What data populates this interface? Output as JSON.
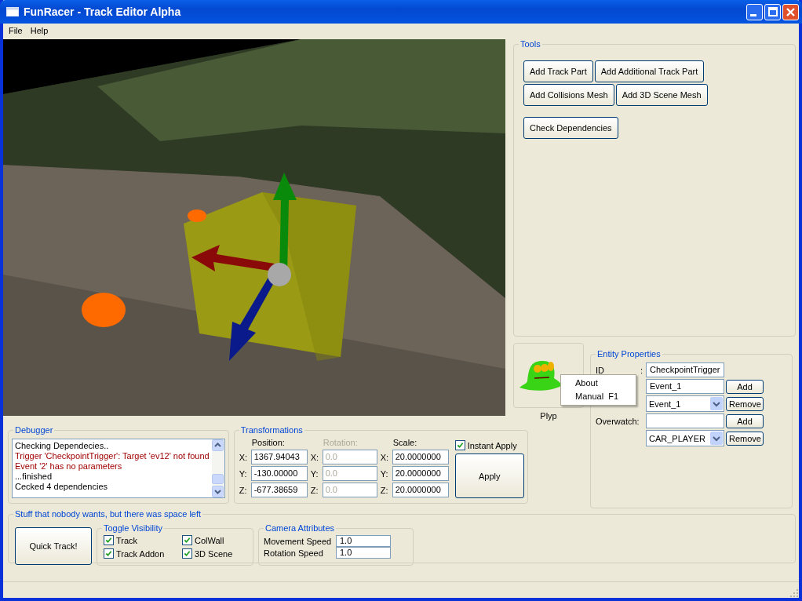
{
  "window": {
    "title": "FunRacer - Track Editor Alpha"
  },
  "menu": [
    "File",
    "Help"
  ],
  "viewport": {
    "kind": "picture"
  },
  "tools": {
    "title": "Tools",
    "rows": [
      [
        "Add Track Part",
        "Add Additional Track Part"
      ],
      [
        "Add Collisions Mesh",
        "Add 3D Scene Mesh"
      ],
      [
        "Check Dependencies"
      ]
    ]
  },
  "mascot": {
    "label": "Plyp"
  },
  "context_menu": [
    {
      "label": "About"
    },
    {
      "label": "Manual",
      "shortcut": "F1"
    }
  ],
  "entity_properties": {
    "title": "Entity Properties",
    "rows": [
      {
        "kind": "field",
        "label_parts": [
          "ID",
          ":"
        ],
        "value": "CheckpointTrigger"
      },
      {
        "kind": "field",
        "value": "Event_1",
        "button": "Add"
      },
      {
        "kind": "combo",
        "value": "Event_1",
        "button": "Remove"
      },
      {
        "kind": "field",
        "label": "Overwatch:",
        "button": "Add"
      },
      {
        "kind": "combo",
        "value": "CAR_PLAYER",
        "button": "Remove"
      }
    ]
  },
  "debugger": {
    "title": "Debugger",
    "lines": [
      {
        "kind": "info",
        "text": "Checking Dependecies.."
      },
      {
        "kind": "error",
        "text": "Trigger 'CheckpointTrigger': Target 'ev12' not found"
      },
      {
        "kind": "error",
        "text": "Event '2' has no parameters"
      },
      {
        "kind": "info",
        "text": "...finished"
      },
      {
        "kind": "info",
        "text": "Cecked 4 dependencies"
      }
    ]
  },
  "transformations": {
    "title": "Transformations",
    "groups": [
      {
        "label": "Position:",
        "disabled": false,
        "fields": [
          {
            "axis": "X:",
            "value": "1367.94043"
          },
          {
            "axis": "Y:",
            "value": "-130.00000"
          },
          {
            "axis": "Z:",
            "value": "-677.38659"
          }
        ]
      },
      {
        "label": "Rotation:",
        "disabled": true,
        "fields": [
          {
            "axis": "X:",
            "value": "0.0"
          },
          {
            "axis": "Y:",
            "value": "0.0"
          },
          {
            "axis": "Z:",
            "value": "0.0"
          }
        ]
      },
      {
        "label": "Scale:",
        "disabled": false,
        "fields": [
          {
            "axis": "X:",
            "value": "20.0000000"
          },
          {
            "axis": "Y:",
            "value": "20.0000000"
          },
          {
            "axis": "Z:",
            "value": "20.0000000"
          }
        ]
      }
    ],
    "instant_apply": {
      "label": "Instant Apply",
      "checked": true
    },
    "apply": "Apply"
  },
  "stuff": {
    "title": "Stuff that nobody wants, but there was space left",
    "quick_track": "Quick Track!",
    "visibility": {
      "title": "Toggle Visibility",
      "items": [
        {
          "label": "Track",
          "checked": true
        },
        {
          "label": "ColWall",
          "checked": true
        },
        {
          "label": "Track Addon",
          "checked": true
        },
        {
          "label": "3D Scene",
          "checked": true
        }
      ]
    },
    "camera": {
      "title": "Camera Attributes",
      "rows": [
        {
          "label": "Movement Speed",
          "value": "1.0"
        },
        {
          "label": "Rotation Speed",
          "value": "1.0"
        }
      ]
    }
  }
}
